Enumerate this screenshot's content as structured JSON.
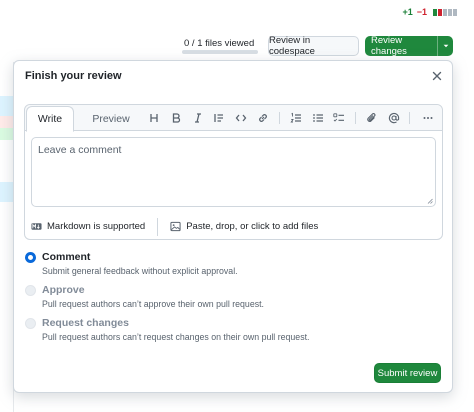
{
  "diffstat": {
    "additions": "+1",
    "deletions": "−1",
    "blocks": [
      "#1f883d",
      "#cf222e",
      "#afb8c1",
      "#afb8c1",
      "#afb8c1"
    ]
  },
  "header": {
    "files_viewed": "0 / 1 files viewed",
    "files_viewed_fraction": 0,
    "codespace_button": "Review in codespace",
    "review_changes_button": "Review changes"
  },
  "review": {
    "title": "Finish your review",
    "tabs": {
      "write": "Write",
      "preview": "Preview"
    },
    "toolbar_icons": [
      "heading-icon",
      "bold-icon",
      "italic-icon",
      "quote-icon",
      "code-icon",
      "link-icon",
      "ordered-list-icon",
      "unordered-list-icon",
      "task-list-icon",
      "attach-icon",
      "mention-icon",
      "more-icon"
    ],
    "comment_placeholder": "Leave a comment",
    "markdown_note": "Markdown is supported",
    "attach_note": "Paste, drop, or click to add files",
    "options": [
      {
        "label": "Comment",
        "description": "Submit general feedback without explicit approval.",
        "selected": true,
        "disabled": false
      },
      {
        "label": "Approve",
        "description": "Pull request authors can’t approve their own pull request.",
        "selected": false,
        "disabled": true
      },
      {
        "label": "Request changes",
        "description": "Pull request authors can’t request changes on their own pull request.",
        "selected": false,
        "disabled": true
      }
    ],
    "submit_button": "Submit review"
  },
  "colors": {
    "primary_green": "#1f883d",
    "accent_blue": "#0969da",
    "border": "#d0d7de"
  }
}
